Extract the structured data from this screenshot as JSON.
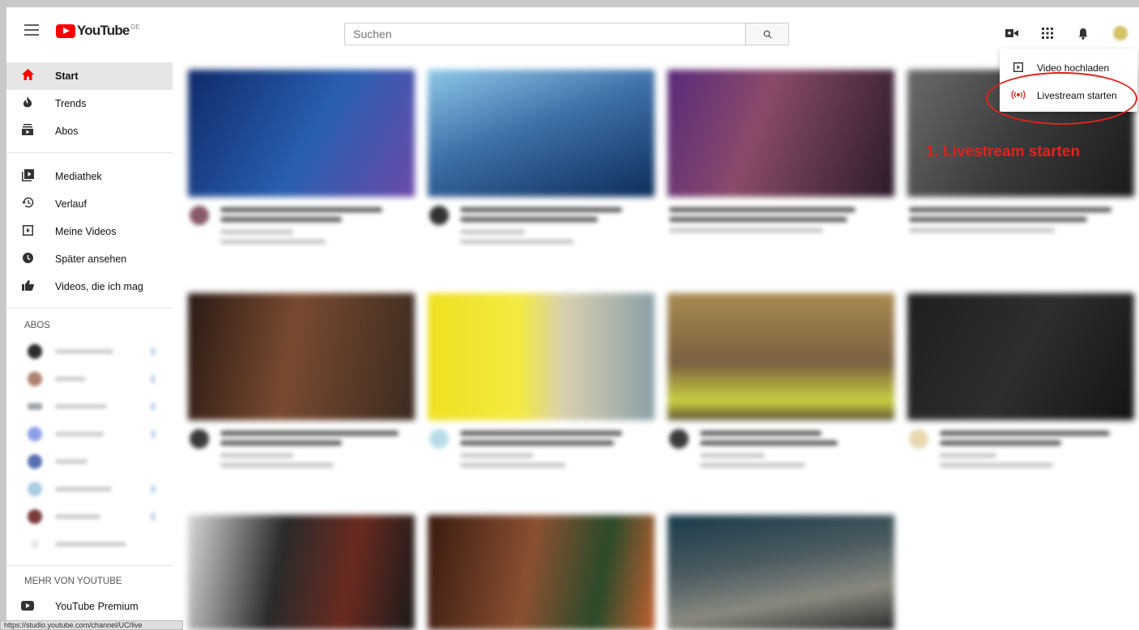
{
  "header": {
    "logo_text": "YouTube",
    "logo_country": "DE",
    "search_placeholder": "Suchen"
  },
  "sidebar": {
    "items": [
      {
        "label": "Start",
        "icon": "home-icon"
      },
      {
        "label": "Trends",
        "icon": "flame-icon"
      },
      {
        "label": "Abos",
        "icon": "subscriptions-icon"
      },
      {
        "label": "Mediathek",
        "icon": "library-icon"
      },
      {
        "label": "Verlauf",
        "icon": "history-icon"
      },
      {
        "label": "Meine Videos",
        "icon": "my-videos-icon"
      },
      {
        "label": "Später ansehen",
        "icon": "watch-later-icon"
      },
      {
        "label": "Videos, die ich mag",
        "icon": "thumbs-up-icon"
      }
    ],
    "abos_heading": "ABOS",
    "more_heading": "MEHR VON YOUTUBE",
    "premium_label": "YouTube Premium"
  },
  "dropdown": {
    "upload_label": "Video hochladen",
    "live_label": "Livestream starten"
  },
  "annotation": "1. Livestream starten",
  "statusbar": "https://studio.youtube.com/channel/UC/live",
  "colors": {
    "brand_red": "#ff0000",
    "annotation_red": "#e2211c"
  }
}
